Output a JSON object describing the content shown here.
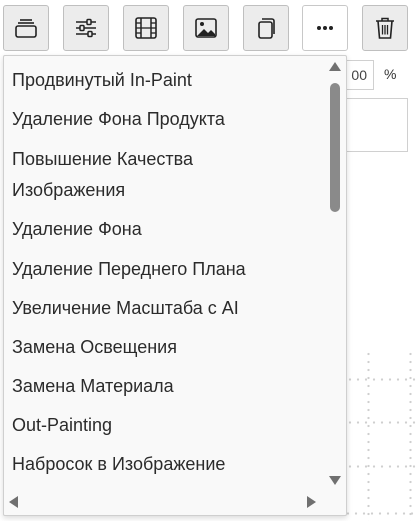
{
  "toolbar": {
    "buttons": [
      {
        "name": "layers-button",
        "icon": "layers-icon"
      },
      {
        "name": "adjustments-button",
        "icon": "sliders-icon"
      },
      {
        "name": "video-button",
        "icon": "film-icon"
      },
      {
        "name": "image-button",
        "icon": "image-icon"
      },
      {
        "name": "duplicate-button",
        "icon": "copy-icon"
      },
      {
        "name": "more-button",
        "icon": "more-icon",
        "active": true
      },
      {
        "name": "delete-button",
        "icon": "trash-icon"
      }
    ]
  },
  "background": {
    "percent_value": "00",
    "percent_unit": "%"
  },
  "menu": {
    "items": [
      "Продвинутый In-Paint",
      "Удаление Фона Продукта",
      "Повышение Качества",
      "Изображения",
      "Удаление Фона",
      "Удаление Переднего Плана",
      "Увеличение Масштаба с AI",
      "Замена Освещения",
      "Замена Материала",
      "Out-Painting",
      "Набросок в Изображение"
    ]
  },
  "colors": {
    "menu_bg": "#f9f9f9",
    "text": "#2b2b2b",
    "scroll_thumb": "#8a8a8a",
    "toolbar_button_bg": "#ececec"
  }
}
